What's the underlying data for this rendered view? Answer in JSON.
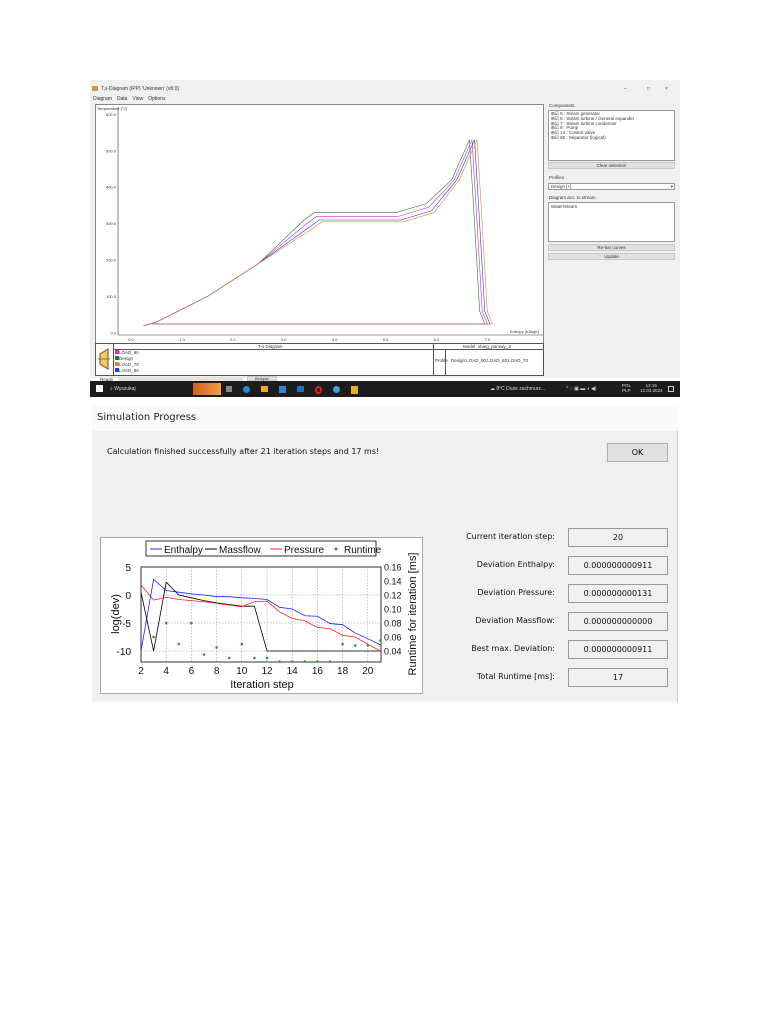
{
  "ts_window": {
    "title": "T,s-Diagram (IPP) 'Unknown' (v8.0)",
    "menu": [
      "Diagram",
      "Data",
      "View",
      "Options"
    ],
    "controls": [
      "−",
      "□",
      "×"
    ],
    "components_label": "Components",
    "components": [
      "5 : Steam generator",
      "6 : Steam turbine / General expander",
      "7 : Steam turbine condenser",
      "8 : Pump",
      "14 : Control valve",
      "80 : Separator (logical)"
    ],
    "clear_selection": "Clear selection",
    "profiles_label": "Profiles",
    "profile_value": "Design [+]",
    "diagram_acc_label": "Diagram acc. to stream",
    "stream_item": "Water/Steam",
    "button_reset": "Re-bar curves",
    "button_update": "Update",
    "legend_title": "T-s Diagram",
    "legend": [
      {
        "name": "LOAD_90",
        "color": "#e020e0"
      },
      {
        "name": "Design",
        "color": "#208020"
      },
      {
        "name": "LOAD_70",
        "color": "#f08030"
      },
      {
        "name": "LOAD_80",
        "color": "#2040e0"
      }
    ],
    "model_label": "Model: obieg_parowy_3",
    "profile_key": "Profile",
    "profile_list": "Design;LOAD_90;LOAD_80;LOAD_70",
    "status": "Ready",
    "status_tab": "Beispiel"
  },
  "taskbar": {
    "search": "Wyszukaj",
    "weather": "8°C Duże zachmurz...",
    "lang1": "POL",
    "lang2": "PLP",
    "time": "12:15",
    "date": "12.03.2024"
  },
  "sim": {
    "title": "Simulation Progress",
    "message": "Calculation finished successfully after 21 iteration steps and 17 ms!",
    "ok": "OK",
    "fields": [
      {
        "label": "Current iteration step:",
        "value": "20"
      },
      {
        "label": "Deviation Enthalpy:",
        "value": "0.000000000911"
      },
      {
        "label": "Deviation Pressure:",
        "value": "0.000000000131"
      },
      {
        "label": "Deviation Massflow:",
        "value": "0.000000000000"
      },
      {
        "label": "Best max. Deviation:",
        "value": "0.000000000911"
      },
      {
        "label": "Total Runtime [ms]:",
        "value": "17"
      }
    ]
  },
  "chart_data": [
    {
      "type": "line",
      "title": "T-s Diagram",
      "xlabel": "Entropy [kJ/kgK]",
      "ylabel": "Temperature [°C]",
      "xlim": [
        0,
        8
      ],
      "ylim": [
        0,
        600
      ],
      "xticks": [
        "0.0",
        "1.0",
        "2.0",
        "3.0",
        "4.0",
        "5.0",
        "6.0",
        "7.0"
      ],
      "yticks": [
        "0.0",
        "100.0",
        "200.0",
        "300.0",
        "400.0",
        "500.0",
        "600.0"
      ],
      "base_curve": [
        [
          0.25,
          20
        ],
        [
          0.5,
          30
        ],
        [
          1.5,
          100
        ],
        [
          2.5,
          190
        ],
        [
          3.4,
          300
        ],
        [
          3.6,
          320
        ],
        [
          5.2,
          320
        ],
        [
          5.8,
          345
        ],
        [
          6.3,
          420
        ],
        [
          6.65,
          530
        ],
        [
          6.75,
          300
        ],
        [
          6.85,
          60
        ],
        [
          6.95,
          25
        ],
        [
          0.4,
          25
        ]
      ],
      "series": [
        {
          "name": "Design",
          "color": "#208020",
          "ds": 0.0,
          "dT": 10
        },
        {
          "name": "LOAD_90",
          "color": "#e020e0",
          "ds": 0.05,
          "dT": 0
        },
        {
          "name": "LOAD_80",
          "color": "#2040e0",
          "ds": 0.1,
          "dT": -10
        },
        {
          "name": "LOAD_70",
          "color": "#f08030",
          "ds": 0.15,
          "dT": -15
        }
      ]
    },
    {
      "type": "line",
      "xlabel": "Iteration step",
      "ylabel": "log(dev)",
      "y2label": "Runtime for iteration [ms]",
      "xlim": [
        2,
        21
      ],
      "ylim": [
        -12,
        5
      ],
      "y2lim": [
        0.025,
        0.16
      ],
      "xticks": [
        "2",
        "4",
        "6",
        "8",
        "10",
        "12",
        "14",
        "16",
        "18",
        "20"
      ],
      "yticks": [
        "5",
        "0",
        "-5",
        "-10"
      ],
      "y2ticks": [
        "0.16",
        "0.14",
        "0.12",
        "0.10",
        "0.08",
        "0.06",
        "0.04"
      ],
      "x": [
        2,
        3,
        4,
        5,
        6,
        7,
        8,
        9,
        10,
        11,
        12,
        13,
        14,
        15,
        16,
        17,
        18,
        19,
        20,
        21
      ],
      "series": [
        {
          "name": "Enthalpy",
          "color": "#2020ff",
          "values": [
            -10,
            2.8,
            0.8,
            0.5,
            0.2,
            0,
            -0.3,
            -0.3,
            -0.5,
            -0.6,
            -0.8,
            -2.2,
            -2.5,
            -3.7,
            -3.8,
            -5.1,
            -5.3,
            -6.8,
            -7.8,
            -8.9
          ]
        },
        {
          "name": "Massflow",
          "color": "#000000",
          "values": [
            0.5,
            -10,
            2.3,
            0,
            -0.5,
            -1,
            -1.4,
            -1.7,
            -2,
            -2,
            -10,
            -10,
            -10,
            -10,
            -10,
            -10,
            -10,
            -10,
            -10,
            -10
          ]
        },
        {
          "name": "Pressure",
          "color": "#ff2020",
          "values": [
            1.8,
            -0.9,
            -0.4,
            -0.8,
            -1,
            -1.2,
            -1.5,
            -1.8,
            -2.1,
            -1.2,
            -1.1,
            -3,
            -4.2,
            -4.6,
            -5.8,
            -6,
            -7.2,
            -7.5,
            -8.8,
            -10
          ]
        },
        {
          "name": "Runtime",
          "color": "#20a020",
          "axis": "right",
          "values": [
            null,
            0.06,
            0.08,
            0.05,
            0.08,
            0.035,
            0.045,
            0.03,
            0.05,
            0.03,
            0.03,
            0.025,
            0.025,
            0.025,
            0.025,
            0.025,
            0.05,
            0.048,
            0.048,
            0.055
          ]
        }
      ]
    }
  ]
}
